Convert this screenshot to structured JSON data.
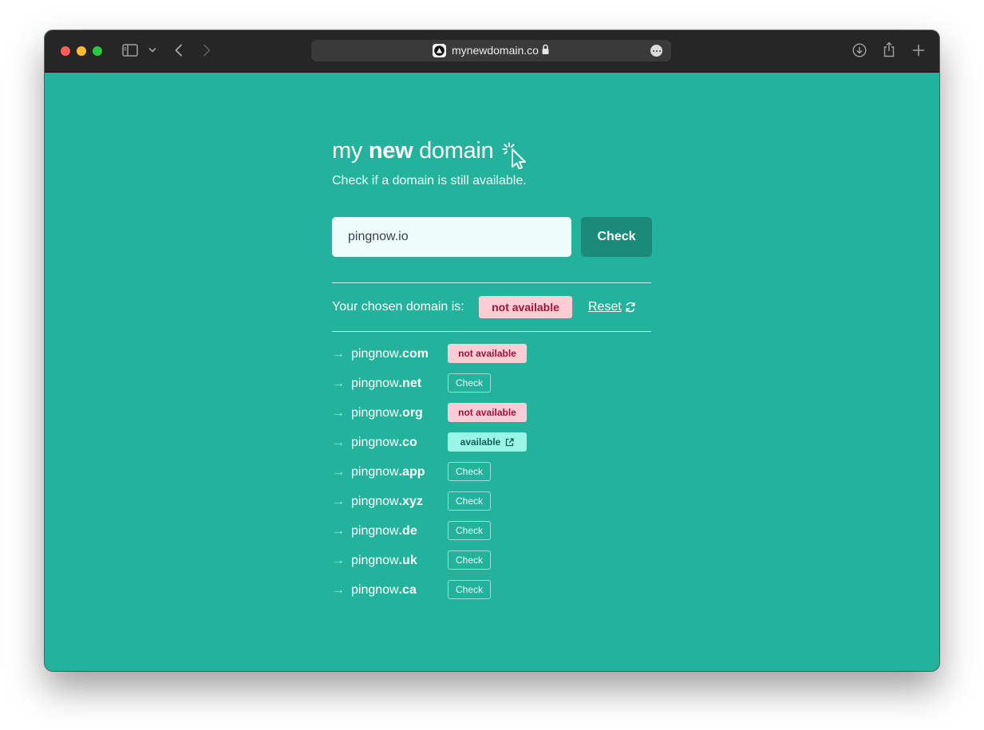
{
  "browser": {
    "url": "mynewdomain.co"
  },
  "header": {
    "brand_prefix": "my",
    "brand_bold": "new",
    "brand_suffix": "domain",
    "subtitle": "Check if a domain is still available."
  },
  "search": {
    "value": "pingnow.io",
    "button_label": "Check"
  },
  "result": {
    "label": "Your chosen domain is:",
    "status": "not available",
    "reset_label": "Reset"
  },
  "alternatives": [
    {
      "base": "pingnow",
      "tld": ".com",
      "status": "not available",
      "kind": "not"
    },
    {
      "base": "pingnow",
      "tld": ".net",
      "status": "Check",
      "kind": "check"
    },
    {
      "base": "pingnow",
      "tld": ".org",
      "status": "not available",
      "kind": "not"
    },
    {
      "base": "pingnow",
      "tld": ".co",
      "status": "available",
      "kind": "avail"
    },
    {
      "base": "pingnow",
      "tld": ".app",
      "status": "Check",
      "kind": "check"
    },
    {
      "base": "pingnow",
      "tld": ".xyz",
      "status": "Check",
      "kind": "check"
    },
    {
      "base": "pingnow",
      "tld": ".de",
      "status": "Check",
      "kind": "check"
    },
    {
      "base": "pingnow",
      "tld": ".uk",
      "status": "Check",
      "kind": "check"
    },
    {
      "base": "pingnow",
      "tld": ".ca",
      "status": "Check",
      "kind": "check"
    }
  ],
  "colors": {
    "background": "#23b39d",
    "primary_button": "#1c8a7a",
    "not_available_bg": "#fecdd3",
    "not_available_text": "#9f1239",
    "available_bg": "#99f6e4",
    "available_text": "#115e59"
  },
  "icons": {
    "arrow": "→"
  }
}
